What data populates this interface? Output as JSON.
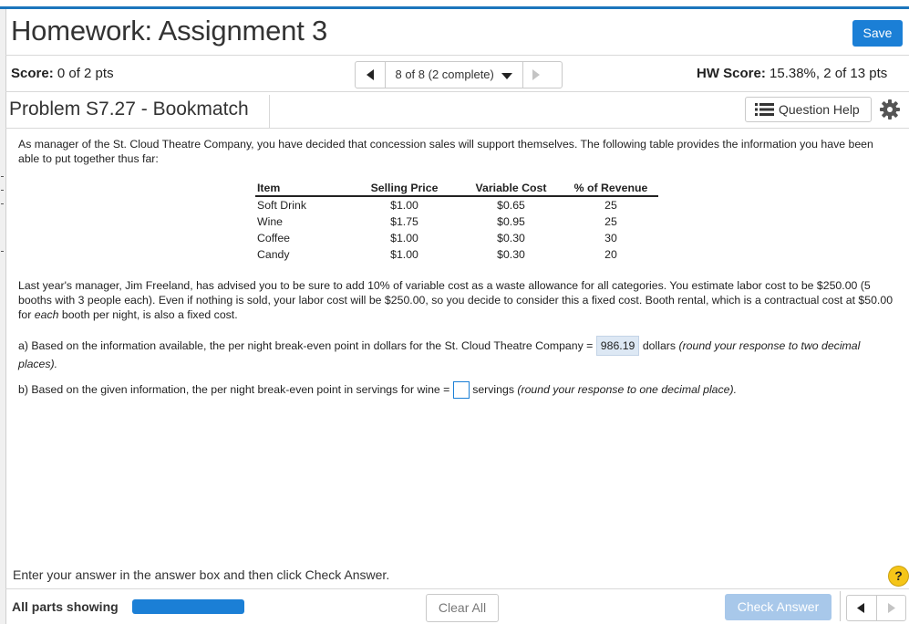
{
  "header": {
    "title": "Homework: Assignment 3",
    "save_label": "Save"
  },
  "status": {
    "score_label": "Score:",
    "score_value": "0 of 2 pts",
    "pager_text": "8 of 8 (2 complete)",
    "hw_score_label": "HW Score:",
    "hw_score_value": "15.38%, 2 of 13 pts"
  },
  "problem": {
    "title": "Problem S7.27 - Bookmatch",
    "question_help_label": "Question Help",
    "intro": "As manager of the St. Cloud Theatre Company, you have decided that concession sales will support themselves. The following table provides the information you have been able to put together thus far:",
    "table": {
      "headers": [
        "Item",
        "Selling Price",
        "Variable Cost",
        "% of Revenue"
      ],
      "rows": [
        [
          "Soft Drink",
          "$1.00",
          "$0.65",
          "25"
        ],
        [
          "Wine",
          "$1.75",
          "$0.95",
          "25"
        ],
        [
          "Coffee",
          "$1.00",
          "$0.30",
          "30"
        ],
        [
          "Candy",
          "$1.00",
          "$0.30",
          "20"
        ]
      ]
    },
    "context_part1": "Last year's manager, Jim Freeland, has advised you to be sure to add 10% of variable cost as a waste allowance for all categories. You estimate labor cost to be $250.00 (5 booths with 3 people each). Even if nothing is sold, your labor cost will be $250.00, so you decide to consider this a fixed cost. Booth rental, which is a contractual cost at $50.00 for ",
    "context_em": "each",
    "context_part2": " booth per night, is also a fixed cost.",
    "part_a_prefix": "a) Based on the information available, the per night break-even point in dollars for the St. Cloud Theatre Company = ",
    "part_a_answer": "986.19",
    "part_a_suffix": " dollars ",
    "part_a_note": "(round your response to two decimal places).",
    "part_b_prefix": "b) Based on the given information, the per night break-even point in servings for wine = ",
    "part_b_answer": "",
    "part_b_suffix": " servings ",
    "part_b_note": "(round your response to one decimal place)."
  },
  "footer": {
    "instruction": "Enter your answer in the answer box and then click Check Answer.",
    "help_symbol": "?",
    "parts_label": "All parts showing",
    "progress": 1.0,
    "clear_label": "Clear All",
    "check_label": "Check Answer"
  },
  "colors": {
    "accent": "#1b7fd6",
    "check_disabled": "#a8c8ea",
    "answer_fill": "#dde8f4",
    "help_yellow": "#f5c518"
  },
  "icons": [
    "prev-arrow-icon",
    "dropdown-caret-icon",
    "next-arrow-icon",
    "list-icon",
    "gear-icon",
    "help-icon"
  ]
}
